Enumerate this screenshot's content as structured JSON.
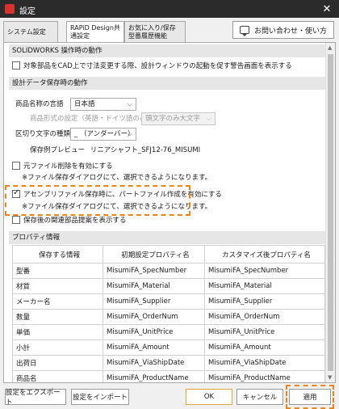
{
  "window": {
    "title": "設定",
    "close_glyph": "✕"
  },
  "tabs": [
    {
      "label": "システム設定"
    },
    {
      "label": "RAPiD Design共通設定"
    },
    {
      "label": "お気に入り/保存型番履歴機能"
    }
  ],
  "inquiry_button": {
    "label": "お問い合わせ・使い方",
    "icon": "chat-icon"
  },
  "solidworks_section": {
    "header": "SOLIDWORKS 操作時の動作",
    "option": {
      "label": "対象部品をCAD上で寸法変更する際、設計ウィンドウの起動を促す警告画面を表示する",
      "checked": false
    }
  },
  "save_section": {
    "header": "設計データ保存時の動作",
    "product_name_lang": {
      "label": "商品名称の言語",
      "value": "日本語"
    },
    "product_format": {
      "label": "商品形式の設定（英語・ドイツ語のみ）",
      "value": "頭文字のみ大文字",
      "disabled": true
    },
    "delimiter": {
      "label": "区切り文字の種類",
      "value": "_ （アンダーバー）"
    },
    "preview": {
      "label": "保存例プレビュー",
      "value": "リニアシャフト_SFJ12-76_MISUMI"
    },
    "delete_original": {
      "label": "元ファイル削除を有効にする",
      "checked": false,
      "note": "※ファイル保存ダイアログにて、選択できるようになります。"
    },
    "assembly_part": {
      "label": "アセンブリファイル保存時に、パートファイル作成を有効にする",
      "checked": true,
      "note": "※ファイル保存ダイアログにて、選択できるようになります。"
    },
    "related_parts": {
      "label": "保存後の関連部品提案を表示する",
      "checked": false
    }
  },
  "property_section": {
    "header": "プロパティ情報",
    "columns": [
      "保存する情報",
      "初期設定プロパティ名",
      "カスタマイズ後プロパティ名"
    ],
    "rows": [
      [
        "型番",
        "MisumiFA_SpecNumber",
        "MisumiFA_SpecNumber"
      ],
      [
        "材質",
        "MisumiFA_Material",
        "MisumiFA_Material"
      ],
      [
        "メーカー名",
        "MisumiFA_Supplier",
        "MisumiFA_Supplier"
      ],
      [
        "数量",
        "MisumiFA_OrderNum",
        "MisumiFA_OrderNum"
      ],
      [
        "単価",
        "MisumiFA_UnitPrice",
        "MisumiFA_UnitPrice"
      ],
      [
        "小計",
        "MisumiFA_Amount",
        "MisumiFA_Amount"
      ],
      [
        "出荷日",
        "MisumiFA_ViaShipDate",
        "MisumiFA_ViaShipDate"
      ],
      [
        "商品名",
        "MisumiFA_ProductName",
        "MisumiFA_ProductName"
      ]
    ]
  },
  "footer": {
    "export_label": "設定をエクスポート",
    "import_label": "設定をインポート",
    "ok_label": "OK",
    "cancel_label": "キャンセル",
    "apply_label": "適用"
  },
  "colors": {
    "highlight": "#e8861a",
    "titlebar": "#2b2b2b"
  }
}
